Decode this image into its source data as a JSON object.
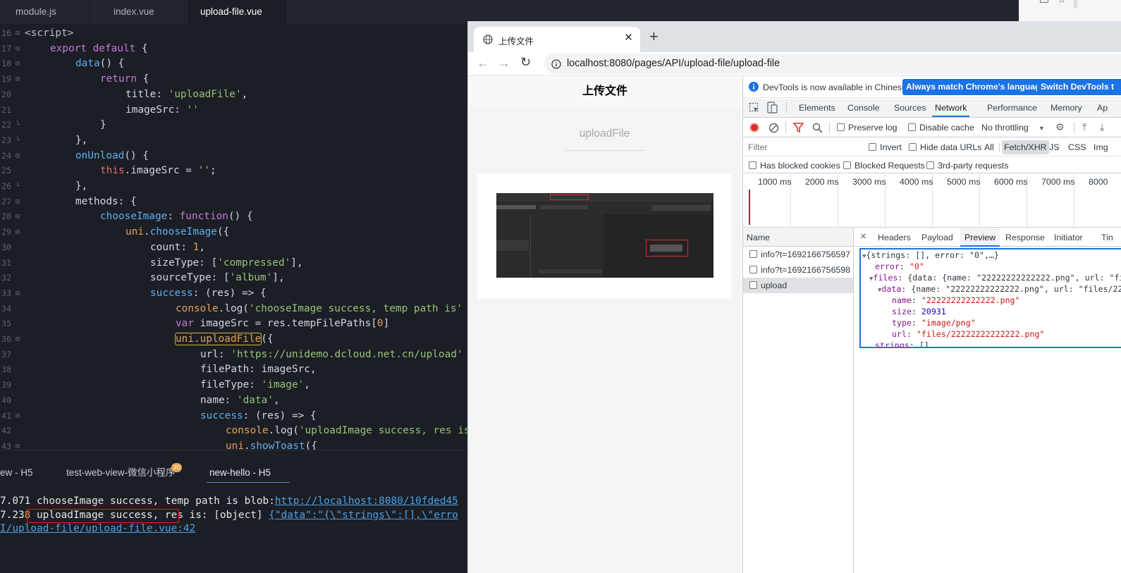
{
  "editor": {
    "tabs": [
      {
        "label": "module.js"
      },
      {
        "label": "index.vue"
      },
      {
        "label": "upload-file.vue",
        "active": true
      }
    ],
    "lines": [
      {
        "n": "16",
        "fold": "⊟"
      },
      {
        "n": "17",
        "fold": "⊟"
      },
      {
        "n": "18",
        "fold": "⊟"
      },
      {
        "n": "19",
        "fold": "⊟"
      },
      {
        "n": "20",
        "fold": ""
      },
      {
        "n": "21",
        "fold": ""
      },
      {
        "n": "22",
        "fold": "└"
      },
      {
        "n": "23",
        "fold": "└"
      },
      {
        "n": "24",
        "fold": "⊟"
      },
      {
        "n": "25",
        "fold": ""
      },
      {
        "n": "26",
        "fold": "└"
      },
      {
        "n": "27",
        "fold": "⊟"
      },
      {
        "n": "28",
        "fold": "⊟"
      },
      {
        "n": "29",
        "fold": "⊟"
      },
      {
        "n": "30",
        "fold": ""
      },
      {
        "n": "31",
        "fold": ""
      },
      {
        "n": "32",
        "fold": ""
      },
      {
        "n": "33",
        "fold": "⊟"
      },
      {
        "n": "34",
        "fold": ""
      },
      {
        "n": "35",
        "fold": ""
      },
      {
        "n": "36",
        "fold": "⊟"
      },
      {
        "n": "37",
        "fold": ""
      },
      {
        "n": "38",
        "fold": ""
      },
      {
        "n": "39",
        "fold": ""
      },
      {
        "n": "40",
        "fold": ""
      },
      {
        "n": "41",
        "fold": "⊟"
      },
      {
        "n": "42",
        "fold": ""
      },
      {
        "n": "43",
        "fold": "⊟"
      }
    ],
    "code": {
      "l16": "<script>",
      "l17_kw": "export default",
      "l17_p": " {",
      "l18_fn": "data",
      "l18_p": "() {",
      "l19_kw": "return",
      "l19_p": " {",
      "l20_k": "title: ",
      "l20_s": "'uploadFile'",
      "l20_p": ",",
      "l21_k": "imageSrc: ",
      "l21_s": "''",
      "l22": "}",
      "l23": "},",
      "l24_fn": "onUnload",
      "l24_p": "() {",
      "l25_th": "this",
      "l25_k": ".imageSrc = ",
      "l25_s": "''",
      "l25_p": ";",
      "l26": "},",
      "l27": "methods: {",
      "l28_fn": "chooseImage",
      "l28_p": ": ",
      "l28_kw": "function",
      "l28_p2": "() {",
      "l29_a": "uni",
      "l29_b": ".",
      "l29_fn": "chooseImage",
      "l29_p": "({",
      "l30_k": "count: ",
      "l30_n": "1",
      "l30_p": ",",
      "l31_k": "sizeType: [",
      "l31_s": "'compressed'",
      "l31_p": "],",
      "l32_k": "sourceType: [",
      "l32_s": "'album'",
      "l32_p": "],",
      "l33_fn": "success",
      "l33_p": ": (res) => {",
      "l34_a": "console",
      "l34_b": ".log(",
      "l34_s": "'chooseImage success, temp path is'",
      "l35_kw": "var",
      "l35_p": " imageSrc = res.tempFilePaths[",
      "l35_n": "0",
      "l35_p2": "]",
      "l36_a": "uni.uploadFile",
      "l36_p": "({",
      "l37_k": "url: ",
      "l37_s": "'https://unidemo.dcloud.net.cn/upload'",
      "l38": "filePath: imageSrc,",
      "l39_k": "fileType: ",
      "l39_s": "'image'",
      "l39_p": ",",
      "l40_k": "name: ",
      "l40_s": "'data'",
      "l40_p": ",",
      "l41_fn": "success",
      "l41_p": ": (res) => {",
      "l42_a": "console",
      "l42_b": ".log(",
      "l42_s": "'uploadImage success, res is",
      "l43_a": "uni",
      "l43_b": ".",
      "l43_fn": "showToast",
      "l43_p": "({"
    }
  },
  "console": {
    "tabs": [
      {
        "label": "ew - H5"
      },
      {
        "label": "test-web-view-微信小程序"
      },
      {
        "label": "new-hello - H5",
        "active": true
      }
    ],
    "badge": "20",
    "line1_time": "7.071",
    "line1_text": " chooseImage success, temp path is blob:",
    "line1_link": "http://localhost:8080/10fded45",
    "line2_time": "7.23",
    "line2_time2": "8",
    "line2_text": " uploadImage success, res is: [object] ",
    "line2_link": "{\"data\":\"{\\\"strings\\\":[],\\\"erro",
    "line3_link": "I/upload-file/upload-file.vue:42"
  },
  "browser": {
    "tab_title": "上传文件",
    "close": "×",
    "new_tab": "+",
    "url": "localhost:8080/pages/API/upload-file/upload-file",
    "page": {
      "title": "上传文件",
      "subtitle": "uploadFile"
    }
  },
  "devtools": {
    "notice": "DevTools is now available in Chinese!",
    "btn_match": "Always match Chrome's language",
    "btn_switch": "Switch DevTools t",
    "tabs": [
      "Elements",
      "Console",
      "Sources",
      "Network",
      "Performance",
      "Memory",
      "Ap"
    ],
    "active_tab": "Network",
    "toolbar": {
      "preserve_log": "Preserve log",
      "disable_cache": "Disable cache",
      "throttling": "No throttling"
    },
    "filter": {
      "placeholder": "Filter",
      "invert": "Invert",
      "hide_data_urls": "Hide data URLs",
      "types": [
        "All",
        "Fetch/XHR",
        "JS",
        "CSS",
        "Img"
      ],
      "active_type": "Fetch/XHR"
    },
    "opts": {
      "blocked_cookies": "Has blocked cookies",
      "blocked_requests": "Blocked Requests",
      "third_party": "3rd-party requests"
    },
    "timeline": [
      "1000 ms",
      "2000 ms",
      "3000 ms",
      "4000 ms",
      "5000 ms",
      "6000 ms",
      "7000 ms",
      "8000"
    ],
    "name_header": "Name",
    "requests": [
      {
        "name": "info?t=1692166756597"
      },
      {
        "name": "info?t=1692166756598"
      },
      {
        "name": "upload",
        "selected": true
      }
    ],
    "detail_close": "×",
    "detail_tabs": [
      "Headers",
      "Payload",
      "Preview",
      "Response",
      "Initiator",
      "Tin"
    ],
    "active_detail_tab": "Preview",
    "preview": {
      "root": "{strings: [], error: \"0\",…}",
      "error_k": "error",
      "error_v": "\"0\"",
      "files_k": "files",
      "files_v": "{data: {name: \"22222222222222.png\", url: \"fi",
      "data_k": "data",
      "data_v": "{name: \"22222222222222.png\", url: \"files/22",
      "name_k": "name",
      "name_v": "\"22222222222222.png\"",
      "size_k": "size",
      "size_v": "20931",
      "type_k": "type",
      "type_v": "\"image/png\"",
      "url_k": "url",
      "url_v": "\"files/22222222222222.png\"",
      "strings_k": "strings",
      "strings_v": "[]"
    }
  },
  "colors": {
    "accent": "#1a73e8",
    "record": "#d93025",
    "highlight": "#e02020"
  }
}
